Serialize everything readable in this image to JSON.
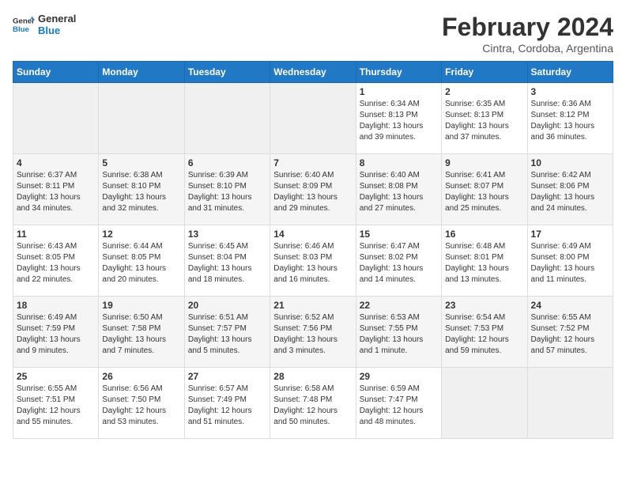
{
  "header": {
    "logo_general": "General",
    "logo_blue": "Blue",
    "month_year": "February 2024",
    "location": "Cintra, Cordoba, Argentina"
  },
  "weekdays": [
    "Sunday",
    "Monday",
    "Tuesday",
    "Wednesday",
    "Thursday",
    "Friday",
    "Saturday"
  ],
  "weeks": [
    [
      {
        "day": "",
        "info": ""
      },
      {
        "day": "",
        "info": ""
      },
      {
        "day": "",
        "info": ""
      },
      {
        "day": "",
        "info": ""
      },
      {
        "day": "1",
        "info": "Sunrise: 6:34 AM\nSunset: 8:13 PM\nDaylight: 13 hours\nand 39 minutes."
      },
      {
        "day": "2",
        "info": "Sunrise: 6:35 AM\nSunset: 8:13 PM\nDaylight: 13 hours\nand 37 minutes."
      },
      {
        "day": "3",
        "info": "Sunrise: 6:36 AM\nSunset: 8:12 PM\nDaylight: 13 hours\nand 36 minutes."
      }
    ],
    [
      {
        "day": "4",
        "info": "Sunrise: 6:37 AM\nSunset: 8:11 PM\nDaylight: 13 hours\nand 34 minutes."
      },
      {
        "day": "5",
        "info": "Sunrise: 6:38 AM\nSunset: 8:10 PM\nDaylight: 13 hours\nand 32 minutes."
      },
      {
        "day": "6",
        "info": "Sunrise: 6:39 AM\nSunset: 8:10 PM\nDaylight: 13 hours\nand 31 minutes."
      },
      {
        "day": "7",
        "info": "Sunrise: 6:40 AM\nSunset: 8:09 PM\nDaylight: 13 hours\nand 29 minutes."
      },
      {
        "day": "8",
        "info": "Sunrise: 6:40 AM\nSunset: 8:08 PM\nDaylight: 13 hours\nand 27 minutes."
      },
      {
        "day": "9",
        "info": "Sunrise: 6:41 AM\nSunset: 8:07 PM\nDaylight: 13 hours\nand 25 minutes."
      },
      {
        "day": "10",
        "info": "Sunrise: 6:42 AM\nSunset: 8:06 PM\nDaylight: 13 hours\nand 24 minutes."
      }
    ],
    [
      {
        "day": "11",
        "info": "Sunrise: 6:43 AM\nSunset: 8:05 PM\nDaylight: 13 hours\nand 22 minutes."
      },
      {
        "day": "12",
        "info": "Sunrise: 6:44 AM\nSunset: 8:05 PM\nDaylight: 13 hours\nand 20 minutes."
      },
      {
        "day": "13",
        "info": "Sunrise: 6:45 AM\nSunset: 8:04 PM\nDaylight: 13 hours\nand 18 minutes."
      },
      {
        "day": "14",
        "info": "Sunrise: 6:46 AM\nSunset: 8:03 PM\nDaylight: 13 hours\nand 16 minutes."
      },
      {
        "day": "15",
        "info": "Sunrise: 6:47 AM\nSunset: 8:02 PM\nDaylight: 13 hours\nand 14 minutes."
      },
      {
        "day": "16",
        "info": "Sunrise: 6:48 AM\nSunset: 8:01 PM\nDaylight: 13 hours\nand 13 minutes."
      },
      {
        "day": "17",
        "info": "Sunrise: 6:49 AM\nSunset: 8:00 PM\nDaylight: 13 hours\nand 11 minutes."
      }
    ],
    [
      {
        "day": "18",
        "info": "Sunrise: 6:49 AM\nSunset: 7:59 PM\nDaylight: 13 hours\nand 9 minutes."
      },
      {
        "day": "19",
        "info": "Sunrise: 6:50 AM\nSunset: 7:58 PM\nDaylight: 13 hours\nand 7 minutes."
      },
      {
        "day": "20",
        "info": "Sunrise: 6:51 AM\nSunset: 7:57 PM\nDaylight: 13 hours\nand 5 minutes."
      },
      {
        "day": "21",
        "info": "Sunrise: 6:52 AM\nSunset: 7:56 PM\nDaylight: 13 hours\nand 3 minutes."
      },
      {
        "day": "22",
        "info": "Sunrise: 6:53 AM\nSunset: 7:55 PM\nDaylight: 13 hours\nand 1 minute."
      },
      {
        "day": "23",
        "info": "Sunrise: 6:54 AM\nSunset: 7:53 PM\nDaylight: 12 hours\nand 59 minutes."
      },
      {
        "day": "24",
        "info": "Sunrise: 6:55 AM\nSunset: 7:52 PM\nDaylight: 12 hours\nand 57 minutes."
      }
    ],
    [
      {
        "day": "25",
        "info": "Sunrise: 6:55 AM\nSunset: 7:51 PM\nDaylight: 12 hours\nand 55 minutes."
      },
      {
        "day": "26",
        "info": "Sunrise: 6:56 AM\nSunset: 7:50 PM\nDaylight: 12 hours\nand 53 minutes."
      },
      {
        "day": "27",
        "info": "Sunrise: 6:57 AM\nSunset: 7:49 PM\nDaylight: 12 hours\nand 51 minutes."
      },
      {
        "day": "28",
        "info": "Sunrise: 6:58 AM\nSunset: 7:48 PM\nDaylight: 12 hours\nand 50 minutes."
      },
      {
        "day": "29",
        "info": "Sunrise: 6:59 AM\nSunset: 7:47 PM\nDaylight: 12 hours\nand 48 minutes."
      },
      {
        "day": "",
        "info": ""
      },
      {
        "day": "",
        "info": ""
      }
    ]
  ]
}
